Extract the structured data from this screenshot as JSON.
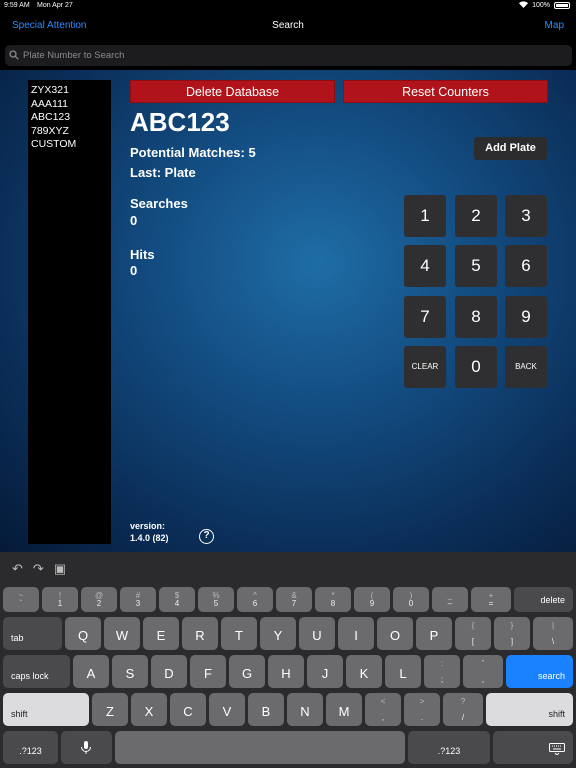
{
  "status_bar": {
    "time": "9:59 AM",
    "date": "Mon Apr 27",
    "battery": "100%"
  },
  "nav": {
    "left": "Special Attention",
    "title": "Search",
    "right": "Map"
  },
  "search": {
    "placeholder": "Plate Number to Search",
    "value": ""
  },
  "plate_list": [
    "ZYX321",
    "AAA111",
    "ABC123",
    "789XYZ",
    "CUSTOM"
  ],
  "buttons": {
    "delete_db": "Delete Database",
    "reset": "Reset Counters",
    "add_plate": "Add Plate"
  },
  "info": {
    "plate": "ABC123",
    "potential": "Potential Matches:  5",
    "last": "Last:  Plate",
    "searches_label": "Searches",
    "searches_value": "0",
    "hits_label": "Hits",
    "hits_value": "0"
  },
  "keypad": [
    "1",
    "2",
    "3",
    "4",
    "5",
    "6",
    "7",
    "8",
    "9",
    "CLEAR",
    "0",
    "BACK"
  ],
  "version": {
    "label": "version:",
    "value": "1.4.0 (82)",
    "help": "?"
  },
  "keyboard": {
    "row1": [
      {
        "t": "~",
        "b": "`"
      },
      {
        "t": "!",
        "b": "1"
      },
      {
        "t": "@",
        "b": "2"
      },
      {
        "t": "#",
        "b": "3"
      },
      {
        "t": "$",
        "b": "4"
      },
      {
        "t": "%",
        "b": "5"
      },
      {
        "t": "^",
        "b": "6"
      },
      {
        "t": "&",
        "b": "7"
      },
      {
        "t": "*",
        "b": "8"
      },
      {
        "t": "(",
        "b": "9"
      },
      {
        "t": ")",
        "b": "0"
      },
      {
        "t": "_",
        "b": "–"
      },
      {
        "t": "+",
        "b": "="
      }
    ],
    "delete": "delete",
    "tab": "tab",
    "row2": [
      "Q",
      "W",
      "E",
      "R",
      "T",
      "Y",
      "U",
      "I",
      "O",
      "P"
    ],
    "row2_sym": [
      {
        "t": "{",
        "b": "["
      },
      {
        "t": "}",
        "b": "]"
      },
      {
        "t": "|",
        "b": "\\"
      }
    ],
    "caps": "caps lock",
    "row3": [
      "A",
      "S",
      "D",
      "F",
      "G",
      "H",
      "J",
      "K",
      "L"
    ],
    "row3_sym": [
      {
        "t": ":",
        "b": ";"
      },
      {
        "t": "”",
        "b": ","
      }
    ],
    "search_key": "search",
    "shift": "shift",
    "row4": [
      "Z",
      "X",
      "C",
      "V",
      "B",
      "N",
      "M"
    ],
    "row4_sym": [
      {
        "t": "<",
        "b": ","
      },
      {
        "t": ">",
        "b": "."
      },
      {
        "t": "?",
        "b": "/"
      }
    ],
    "num": ".?123"
  }
}
